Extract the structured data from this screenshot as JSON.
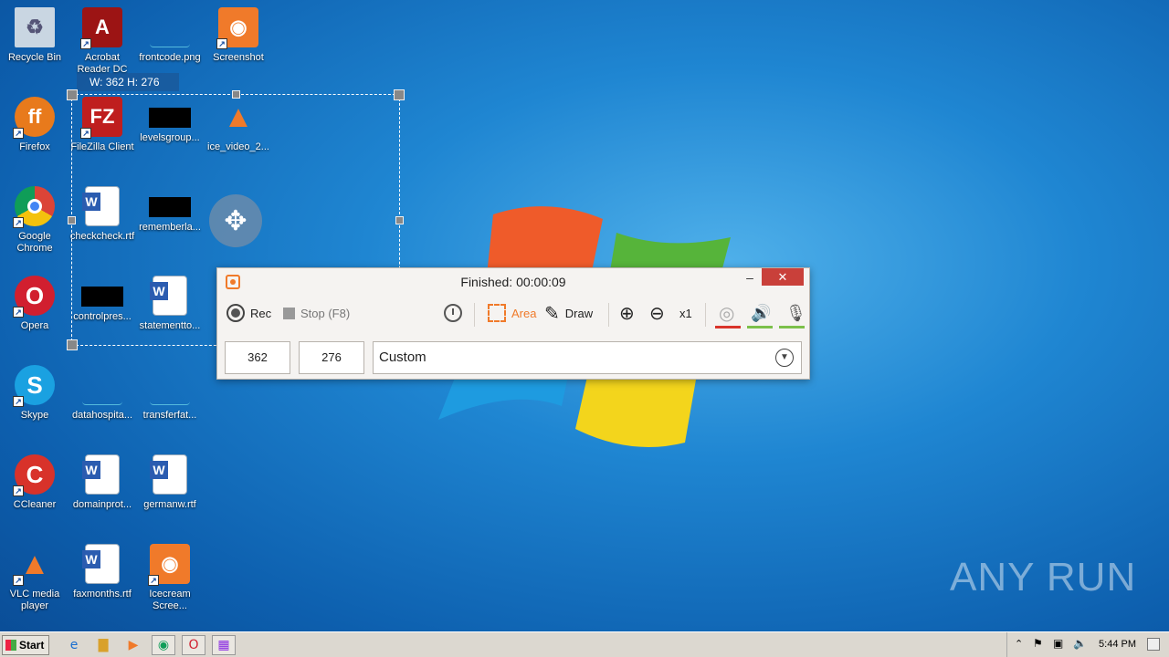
{
  "desktop": {
    "icons": [
      {
        "label": "Recycle Bin"
      },
      {
        "label": "Acrobat Reader DC"
      },
      {
        "label": "frontcode.png"
      },
      {
        "label": "Screenshot"
      },
      {
        "label": "Firefox"
      },
      {
        "label": "FileZilla Client"
      },
      {
        "label": "levelsgroup..."
      },
      {
        "label": "ice_video_2..."
      },
      {
        "label": "Google Chrome"
      },
      {
        "label": "checkcheck.rtf"
      },
      {
        "label": "rememberla..."
      },
      {
        "label": "Opera"
      },
      {
        "label": "controlpres..."
      },
      {
        "label": "statementto..."
      },
      {
        "label": "Skype"
      },
      {
        "label": "datahospita..."
      },
      {
        "label": "transferfat..."
      },
      {
        "label": "CCleaner"
      },
      {
        "label": "domainprot..."
      },
      {
        "label": "germanw.rtf"
      },
      {
        "label": "VLC media player"
      },
      {
        "label": "faxmonths.rtf"
      },
      {
        "label": "Icecream Scree..."
      }
    ],
    "selection_label": "W: 362 H: 276",
    "watermark": "ANY RUN"
  },
  "recorder": {
    "title": "Finished:  00:00:09",
    "minimize": "–",
    "close": "✕",
    "rec_label": "Rec",
    "stop_label": "Stop (F8)",
    "area_label": "Area",
    "draw_label": "Draw",
    "zoom_label": "x1",
    "width_value": "362",
    "height_value": "276",
    "preset_value": "Custom",
    "colors": {
      "accent": "#f07a2a",
      "webcam_bar": "#d9342b",
      "audio_bar": "#7cc04a"
    }
  },
  "taskbar": {
    "start_label": "Start",
    "clock": "5:44 PM",
    "icons": [
      "ie-icon",
      "explorer-icon",
      "media-player-icon",
      "chrome-icon",
      "opera-icon",
      "winrar-icon"
    ]
  }
}
